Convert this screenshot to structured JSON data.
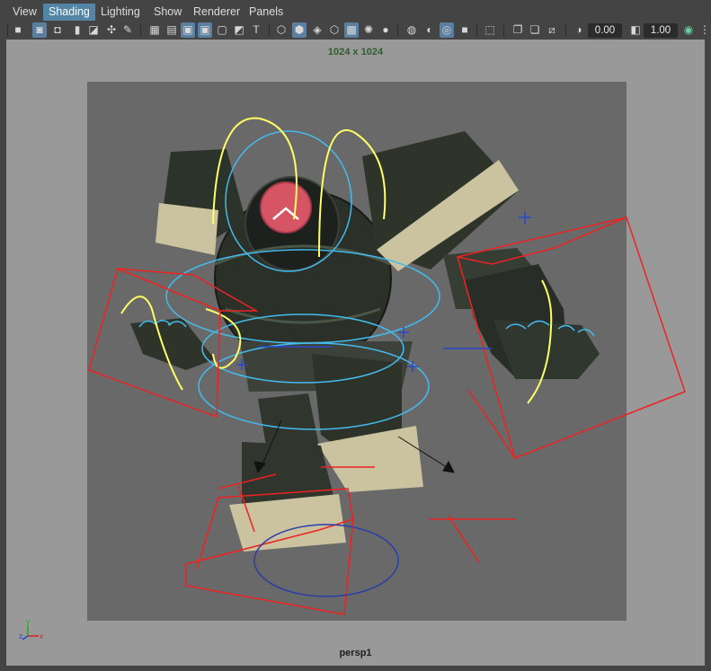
{
  "menu": {
    "items": [
      {
        "label": "View",
        "active": false
      },
      {
        "label": "Shading",
        "active": true
      },
      {
        "label": "Lighting",
        "active": false
      },
      {
        "label": "Show",
        "active": false
      },
      {
        "label": "Renderer",
        "active": false
      },
      {
        "label": "Panels",
        "active": false
      }
    ]
  },
  "toolbar": {
    "value_a": "0.00",
    "value_b": "1.00"
  },
  "viewport": {
    "resolution_label": "1024 x 1024",
    "camera_label": "persp1"
  },
  "colors": {
    "menu_active": "#5285a6",
    "viewport_bg": "#999999",
    "render_region": "#696969",
    "curve_yellow": "#ffff66",
    "curve_cyan": "#44bbee",
    "curve_red": "#ee2222"
  }
}
